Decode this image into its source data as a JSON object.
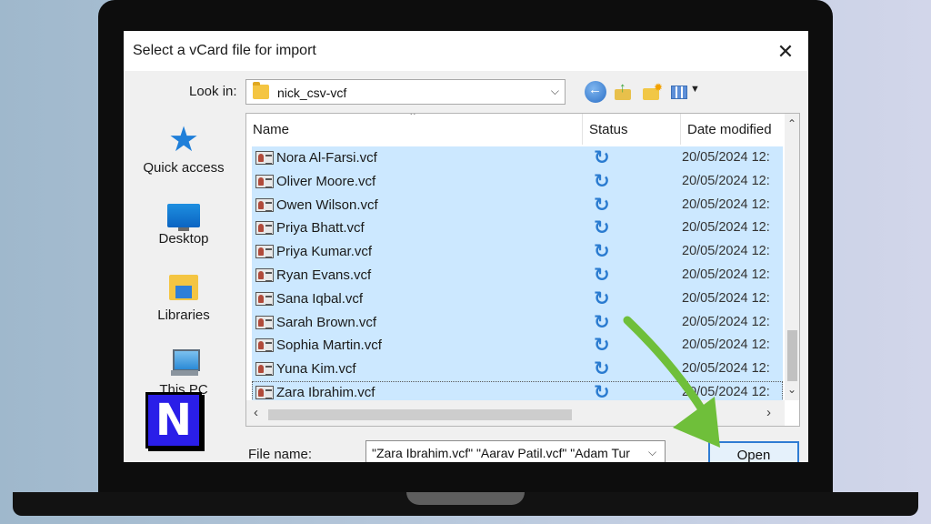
{
  "dialog": {
    "title": "Select a vCard file for import",
    "look_in_label": "Look in:",
    "look_in_value": "nick_csv-vcf"
  },
  "places": [
    {
      "label": "Quick access",
      "icon": "quick-access-star-icon"
    },
    {
      "label": "Desktop",
      "icon": "desktop-icon"
    },
    {
      "label": "Libraries",
      "icon": "libraries-icon"
    },
    {
      "label": "This PC",
      "icon": "this-pc-icon"
    }
  ],
  "columns": {
    "name": "Name",
    "status": "Status",
    "date": "Date modified"
  },
  "files": [
    {
      "name": "Nora Al-Farsi.vcf",
      "date": "20/05/2024 12:"
    },
    {
      "name": "Oliver Moore.vcf",
      "date": "20/05/2024 12:"
    },
    {
      "name": "Owen Wilson.vcf",
      "date": "20/05/2024 12:"
    },
    {
      "name": "Priya Bhatt.vcf",
      "date": "20/05/2024 12:"
    },
    {
      "name": "Priya Kumar.vcf",
      "date": "20/05/2024 12:"
    },
    {
      "name": "Ryan Evans.vcf",
      "date": "20/05/2024 12:"
    },
    {
      "name": "Sana Iqbal.vcf",
      "date": "20/05/2024 12:"
    },
    {
      "name": "Sarah Brown.vcf",
      "date": "20/05/2024 12:"
    },
    {
      "name": "Sophia Martin.vcf",
      "date": "20/05/2024 12:"
    },
    {
      "name": "Yuna Kim.vcf",
      "date": "20/05/2024 12:"
    },
    {
      "name": "Zara Ibrahim.vcf",
      "date": "20/05/2024 12:"
    }
  ],
  "file_name_label": "File name:",
  "file_name_value": "\"Zara Ibrahim.vcf\" \"Aarav Patil.vcf\" \"Adam Tur",
  "open_label": "Open",
  "logo_text": "N",
  "colors": {
    "selection": "#cce8ff",
    "accent": "#2f7cd3",
    "arrow": "#6fbf3a"
  }
}
